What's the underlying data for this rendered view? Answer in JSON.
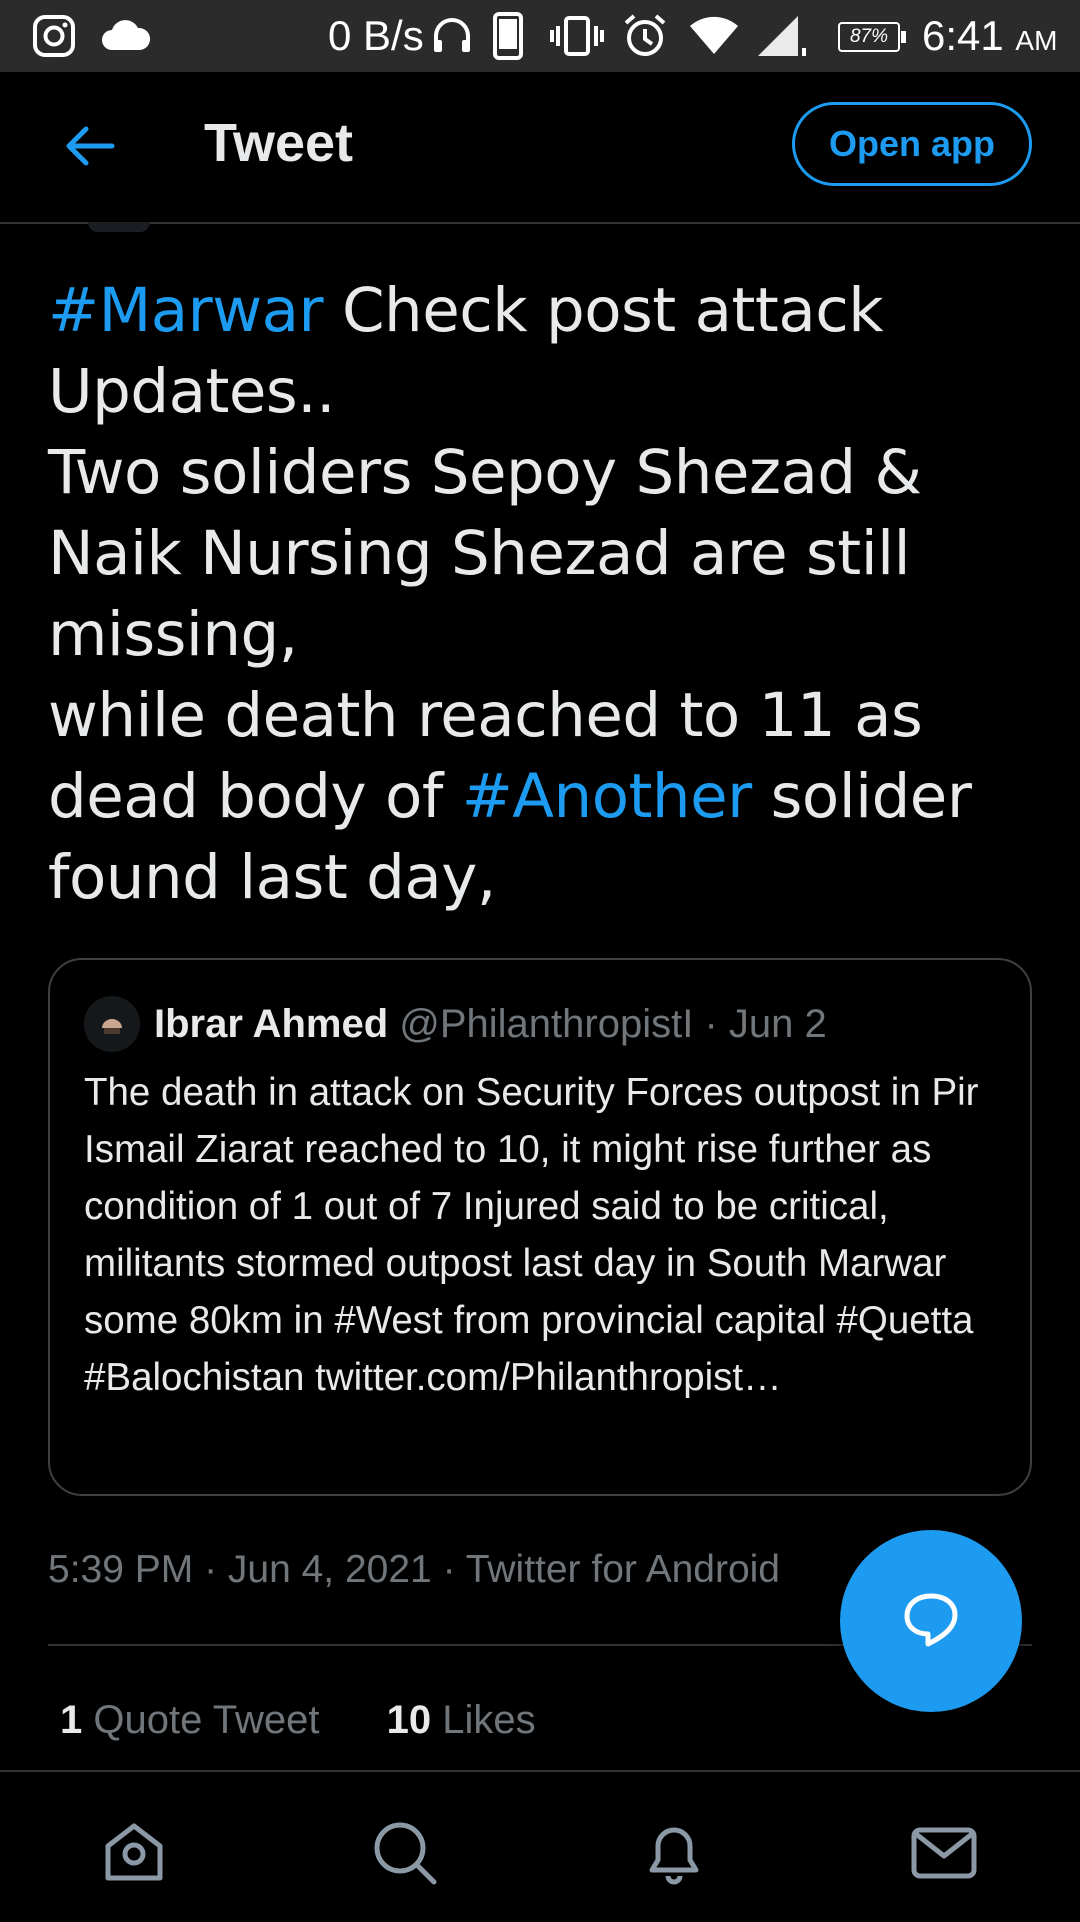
{
  "status_bar": {
    "net_speed": "0 B/s",
    "battery": "87%",
    "time": "6:41",
    "ampm": "AM"
  },
  "header": {
    "title": "Tweet",
    "open_app": "Open app"
  },
  "tweet": {
    "segments": [
      {
        "text": "#Marwar",
        "hashtag": true
      },
      {
        "text": " Check post attack Updates..\nTwo soliders Sepoy Shezad & Naik Nursing Shezad are still missing,\nwhile death reached to 11 as dead body of ",
        "hashtag": false
      },
      {
        "text": "#Another",
        "hashtag": true
      },
      {
        "text": " solider found last day,",
        "hashtag": false
      }
    ],
    "meta": "5:39 PM · Jun 4, 2021 · Twitter for Android"
  },
  "quote": {
    "name": "Ibrar Ahmed",
    "handle": "@PhilanthropistI · Jun 2",
    "text": "The death in attack on Security Forces outpost in Pir Ismail Ziarat reached to 10, it might rise further as condition of 1 out of 7 Injured said to be critical, militants stormed outpost last day in South Marwar some 80km in #West from provincial capital #Quetta #Balochistan twitter.com/Philanthropist…"
  },
  "stats": {
    "quote_count": "1",
    "quote_label": "Quote Tweet",
    "likes_count": "10",
    "likes_label": "Likes"
  },
  "icons": {
    "accent": "#1d9bf0",
    "nav": [
      "home-icon",
      "search-icon",
      "bell-icon",
      "mail-icon"
    ]
  }
}
